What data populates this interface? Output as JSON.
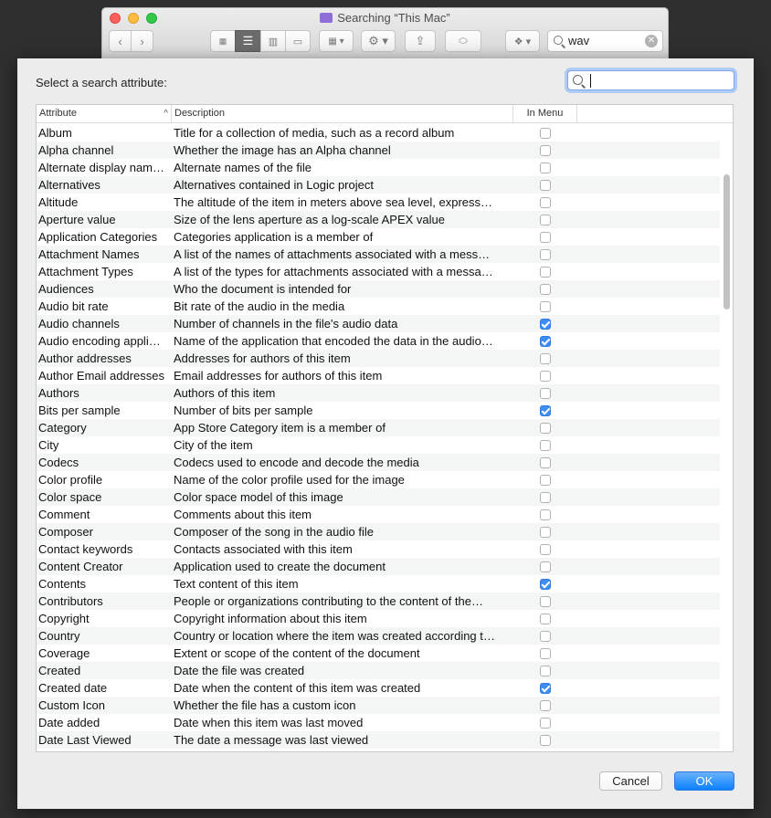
{
  "finder": {
    "title": "Searching “This Mac”",
    "search_value": "wav"
  },
  "dialog": {
    "prompt": "Select a search attribute:",
    "search_value": "",
    "columns": {
      "attribute": "Attribute",
      "description": "Description",
      "in_menu": "In Menu"
    },
    "sort_indicator": "^",
    "cancel_label": "Cancel",
    "ok_label": "OK",
    "accent_color": "#3d8ef4"
  },
  "rows": [
    {
      "attribute": "Album",
      "description": "Title for a collection of media, such as a record album",
      "in_menu": false
    },
    {
      "attribute": "Alpha channel",
      "description": "Whether the image has an Alpha channel",
      "in_menu": false
    },
    {
      "attribute": "Alternate display nam…",
      "description": "Alternate names of the file",
      "in_menu": false
    },
    {
      "attribute": "Alternatives",
      "description": "Alternatives contained in Logic project",
      "in_menu": false
    },
    {
      "attribute": "Altitude",
      "description": "The altitude of the item in meters above sea level, express…",
      "in_menu": false
    },
    {
      "attribute": "Aperture value",
      "description": "Size of the lens aperture as a log-scale APEX value",
      "in_menu": false
    },
    {
      "attribute": "Application Categories",
      "description": "Categories application is a member of",
      "in_menu": false
    },
    {
      "attribute": "Attachment Names",
      "description": "A list of the names of attachments associated with a mess…",
      "in_menu": false
    },
    {
      "attribute": "Attachment Types",
      "description": "A list of the types for attachments associated with a messa…",
      "in_menu": false
    },
    {
      "attribute": "Audiences",
      "description": "Who the document is intended for",
      "in_menu": false
    },
    {
      "attribute": "Audio bit rate",
      "description": "Bit rate of the audio in the media",
      "in_menu": false
    },
    {
      "attribute": "Audio channels",
      "description": "Number of channels in the file's audio data",
      "in_menu": true
    },
    {
      "attribute": "Audio encoding appli…",
      "description": "Name of the application that encoded the data in the audio…",
      "in_menu": true
    },
    {
      "attribute": "Author addresses",
      "description": "Addresses for authors of this item",
      "in_menu": false
    },
    {
      "attribute": "Author Email addresses",
      "description": "Email addresses for authors of this item",
      "in_menu": false
    },
    {
      "attribute": "Authors",
      "description": "Authors of this item",
      "in_menu": false
    },
    {
      "attribute": "Bits per sample",
      "description": "Number of bits per sample",
      "in_menu": true
    },
    {
      "attribute": "Category",
      "description": "App Store Category item is a member of",
      "in_menu": false
    },
    {
      "attribute": "City",
      "description": "City of the item",
      "in_menu": false
    },
    {
      "attribute": "Codecs",
      "description": "Codecs used to encode and decode the media",
      "in_menu": false
    },
    {
      "attribute": "Color profile",
      "description": "Name of the color profile used for the image",
      "in_menu": false
    },
    {
      "attribute": "Color space",
      "description": "Color space model of this image",
      "in_menu": false
    },
    {
      "attribute": "Comment",
      "description": "Comments about this item",
      "in_menu": false
    },
    {
      "attribute": "Composer",
      "description": "Composer of the song in the audio file",
      "in_menu": false
    },
    {
      "attribute": "Contact keywords",
      "description": "Contacts associated with this item",
      "in_menu": false
    },
    {
      "attribute": "Content Creator",
      "description": "Application used to create the document",
      "in_menu": false
    },
    {
      "attribute": "Contents",
      "description": "Text content of this item",
      "in_menu": true
    },
    {
      "attribute": "Contributors",
      "description": "People or organizations contributing to the content of the…",
      "in_menu": false
    },
    {
      "attribute": "Copyright",
      "description": "Copyright information about this item",
      "in_menu": false
    },
    {
      "attribute": "Country",
      "description": "Country or location where the item was created according t…",
      "in_menu": false
    },
    {
      "attribute": "Coverage",
      "description": "Extent or scope of the content of the document",
      "in_menu": false
    },
    {
      "attribute": "Created",
      "description": "Date the file was created",
      "in_menu": false
    },
    {
      "attribute": "Created date",
      "description": "Date when the content of this item was created",
      "in_menu": true
    },
    {
      "attribute": "Custom Icon",
      "description": "Whether the file has a custom icon",
      "in_menu": false
    },
    {
      "attribute": "Date added",
      "description": "Date when this item was last moved",
      "in_menu": false
    },
    {
      "attribute": "Date Last Viewed",
      "description": "The date a message was last viewed",
      "in_menu": false
    }
  ]
}
